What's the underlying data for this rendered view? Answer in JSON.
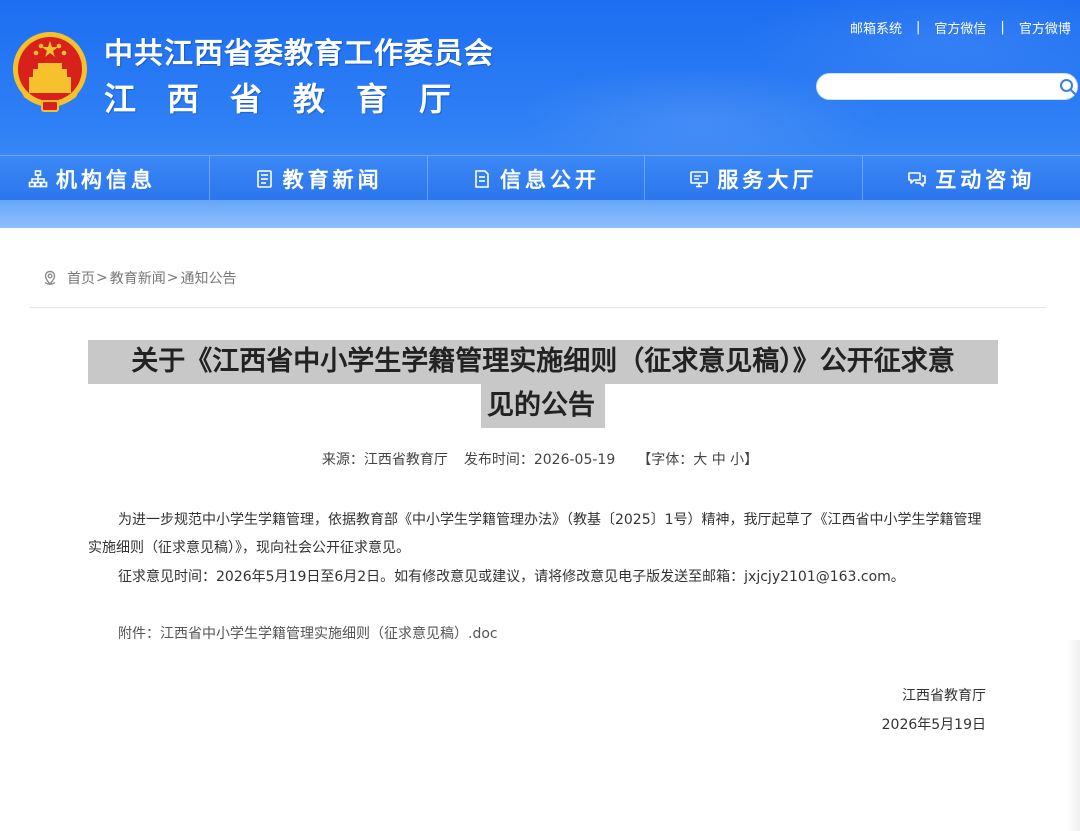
{
  "header": {
    "org_name_1": "中共江西省委教育工作委员会",
    "org_name_2": "江西省教育厅",
    "top_links": [
      "邮箱系统",
      "官方微信",
      "官方微博"
    ],
    "search_placeholder": "",
    "colors": {
      "header_blue": "#2f80f5",
      "emblem_red": "#d8201c",
      "emblem_gold": "#f5c12c"
    }
  },
  "nav": {
    "items": [
      {
        "label": "机构信息",
        "icon": "org-chart-icon"
      },
      {
        "label": "教育新闻",
        "icon": "news-icon"
      },
      {
        "label": "信息公开",
        "icon": "document-icon"
      },
      {
        "label": "服务大厅",
        "icon": "monitor-icon"
      },
      {
        "label": "互动咨询",
        "icon": "chat-icon"
      }
    ]
  },
  "breadcrumb": {
    "items": [
      "首页",
      "教育新闻",
      "通知公告"
    ],
    "separator": ">"
  },
  "article": {
    "title_line_1": "关于《江西省中小学生学籍管理实施细则（征求意见稿）》公开征求意",
    "title_line_2": "见的公告",
    "source_label": "来源：",
    "source": "江西省教育厅",
    "date_label": "发布时间：",
    "date": "2026-05-19",
    "font_label_open": "【字体：",
    "font_sizes": [
      "大",
      "中",
      "小"
    ],
    "font_label_close": "】",
    "paragraph_1": "为进一步规范中小学生学籍管理，依据教育部《中小学生学籍管理办法》（教基〔2025〕1号）精神，我厅起草了《江西省中小学生学籍管理实施细则（征求意见稿）》，现向社会公开征求意见。",
    "paragraph_2": "征求意见时间：2026年5月19日至6月2日。如有修改意见或建议，请将修改意见电子版发送至邮箱：jxjcjy2101@163.com。",
    "attachment_label": "附件：",
    "attachment_file": "江西省中小学生学籍管理实施细则（征求意见稿）.doc",
    "sign_org": "江西省教育厅",
    "sign_date": "2026年5月19日"
  }
}
